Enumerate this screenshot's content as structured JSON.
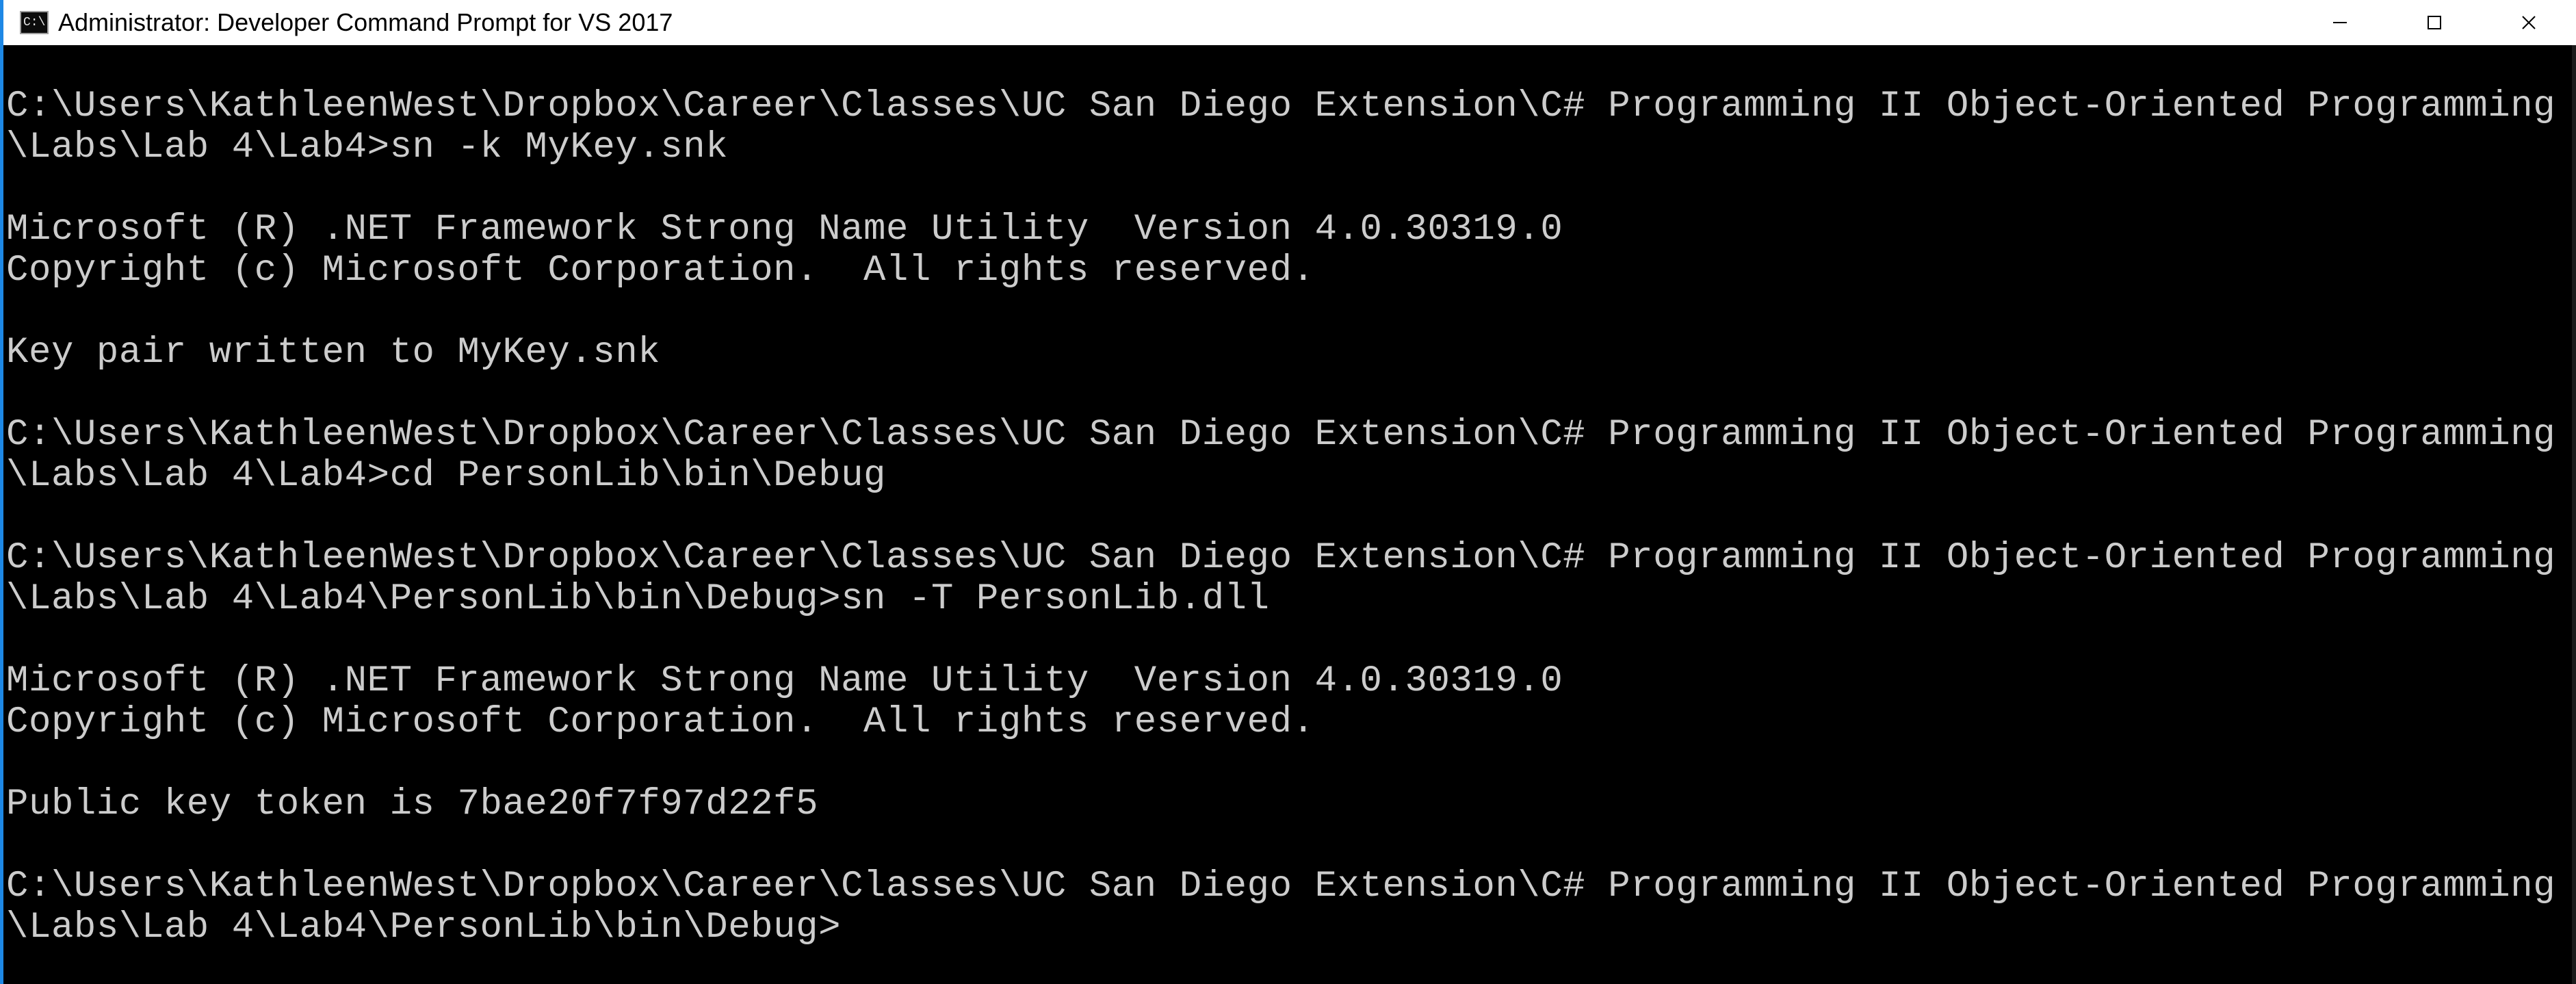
{
  "window": {
    "title": "Administrator: Developer Command Prompt for VS 2017",
    "icon_name": "command-prompt-icon",
    "icon_text": "C:\\.",
    "accent_color": "#1e88e5",
    "caption_buttons": {
      "minimize_icon": "minimize-icon",
      "maximize_icon": "maximize-icon",
      "close_icon": "close-icon"
    }
  },
  "console": {
    "background": "#000000",
    "foreground": "#cccccc",
    "lines": [
      "C:\\Users\\KathleenWest\\Dropbox\\Career\\Classes\\UC San Diego Extension\\C# Programming II Object-Oriented Programming",
      "\\Labs\\Lab 4\\Lab4>sn -k MyKey.snk",
      "",
      "Microsoft (R) .NET Framework Strong Name Utility  Version 4.0.30319.0",
      "Copyright (c) Microsoft Corporation.  All rights reserved.",
      "",
      "Key pair written to MyKey.snk",
      "",
      "C:\\Users\\KathleenWest\\Dropbox\\Career\\Classes\\UC San Diego Extension\\C# Programming II Object-Oriented Programming",
      "\\Labs\\Lab 4\\Lab4>cd PersonLib\\bin\\Debug",
      "",
      "C:\\Users\\KathleenWest\\Dropbox\\Career\\Classes\\UC San Diego Extension\\C# Programming II Object-Oriented Programming",
      "\\Labs\\Lab 4\\Lab4\\PersonLib\\bin\\Debug>sn -T PersonLib.dll",
      "",
      "Microsoft (R) .NET Framework Strong Name Utility  Version 4.0.30319.0",
      "Copyright (c) Microsoft Corporation.  All rights reserved.",
      "",
      "Public key token is 7bae20f7f97d22f5",
      "",
      "C:\\Users\\KathleenWest\\Dropbox\\Career\\Classes\\UC San Diego Extension\\C# Programming II Object-Oriented Programming",
      "\\Labs\\Lab 4\\Lab4\\PersonLib\\bin\\Debug>"
    ]
  }
}
